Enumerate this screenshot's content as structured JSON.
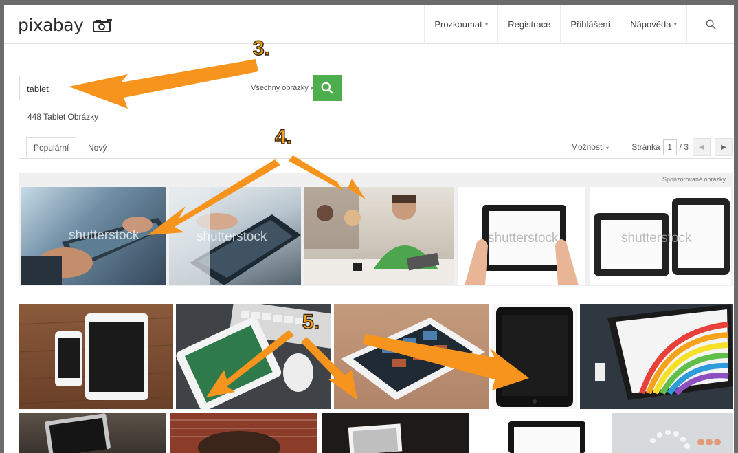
{
  "header": {
    "logo": "pixabay",
    "nav": [
      {
        "label": "Prozkoumat",
        "dropdown": true
      },
      {
        "label": "Registrace",
        "dropdown": false
      },
      {
        "label": "Přihlášení",
        "dropdown": false
      },
      {
        "label": "Nápověda",
        "dropdown": true
      }
    ],
    "search_icon": "search-icon"
  },
  "search": {
    "value": "tablet",
    "filter_label": "Všechny obrázky",
    "button_icon": "search-icon"
  },
  "results": {
    "count_text": "448 Tablet Obrázky"
  },
  "tabs": [
    {
      "label": "Populární",
      "active": true
    },
    {
      "label": "Nový",
      "active": false
    }
  ],
  "options": {
    "label": "Možnosti"
  },
  "pagination": {
    "label": "Stránka",
    "current": "1",
    "total": "/ 3",
    "prev_icon": "chevron-left-icon",
    "next_icon": "chevron-right-icon"
  },
  "sponsored": {
    "label": "Sponzorované obrázky",
    "watermark": "shutterstock"
  },
  "annotations": {
    "step3": "3.",
    "step4": "4.",
    "step5": "5.",
    "arrow_color": "#f7941d"
  },
  "colors": {
    "search_button": "#4cae4c",
    "frame": "#6b6b6b"
  }
}
